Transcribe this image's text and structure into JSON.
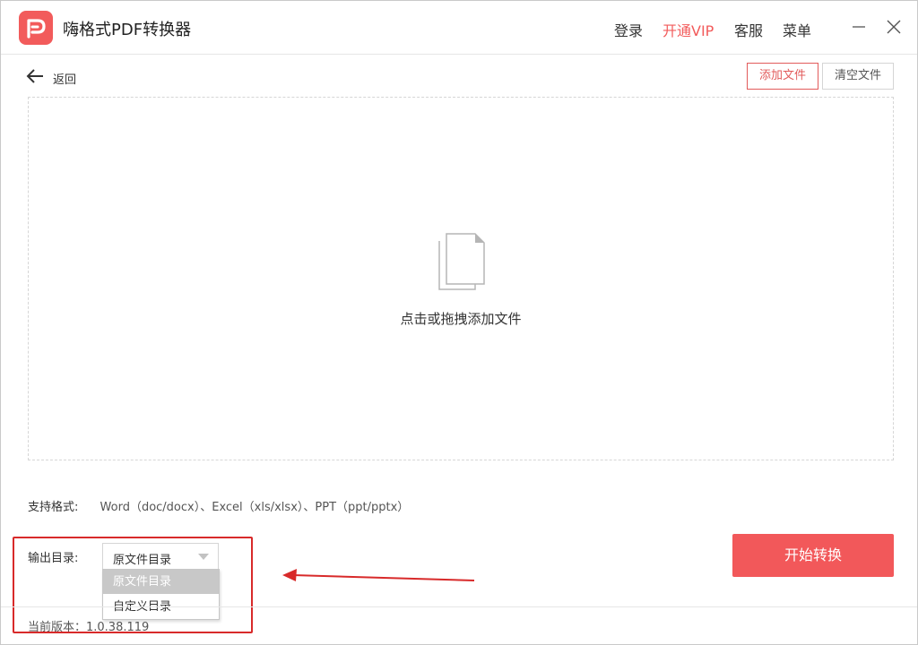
{
  "app": {
    "title": "嗨格式PDF转换器",
    "accent_color": "#f25b5b"
  },
  "nav": {
    "login": "登录",
    "vip": "开通VIP",
    "service": "客服",
    "menu": "菜单"
  },
  "toolbar": {
    "back_label": "返回",
    "add_file": "添加文件",
    "clear_files": "清空文件"
  },
  "dropzone": {
    "hint": "点击或拖拽添加文件",
    "icon": "file-copy-icon"
  },
  "formats": {
    "label": "支持格式:",
    "items": "Word（doc/docx）、Excel（xls/xlsx）、PPT（ppt/pptx）"
  },
  "output": {
    "label": "输出目录:",
    "selected": "原文件目录",
    "options": [
      "原文件目录",
      "自定义目录"
    ]
  },
  "start_button": "开始转换",
  "footer": {
    "version": "当前版本：1.0.38.119"
  }
}
